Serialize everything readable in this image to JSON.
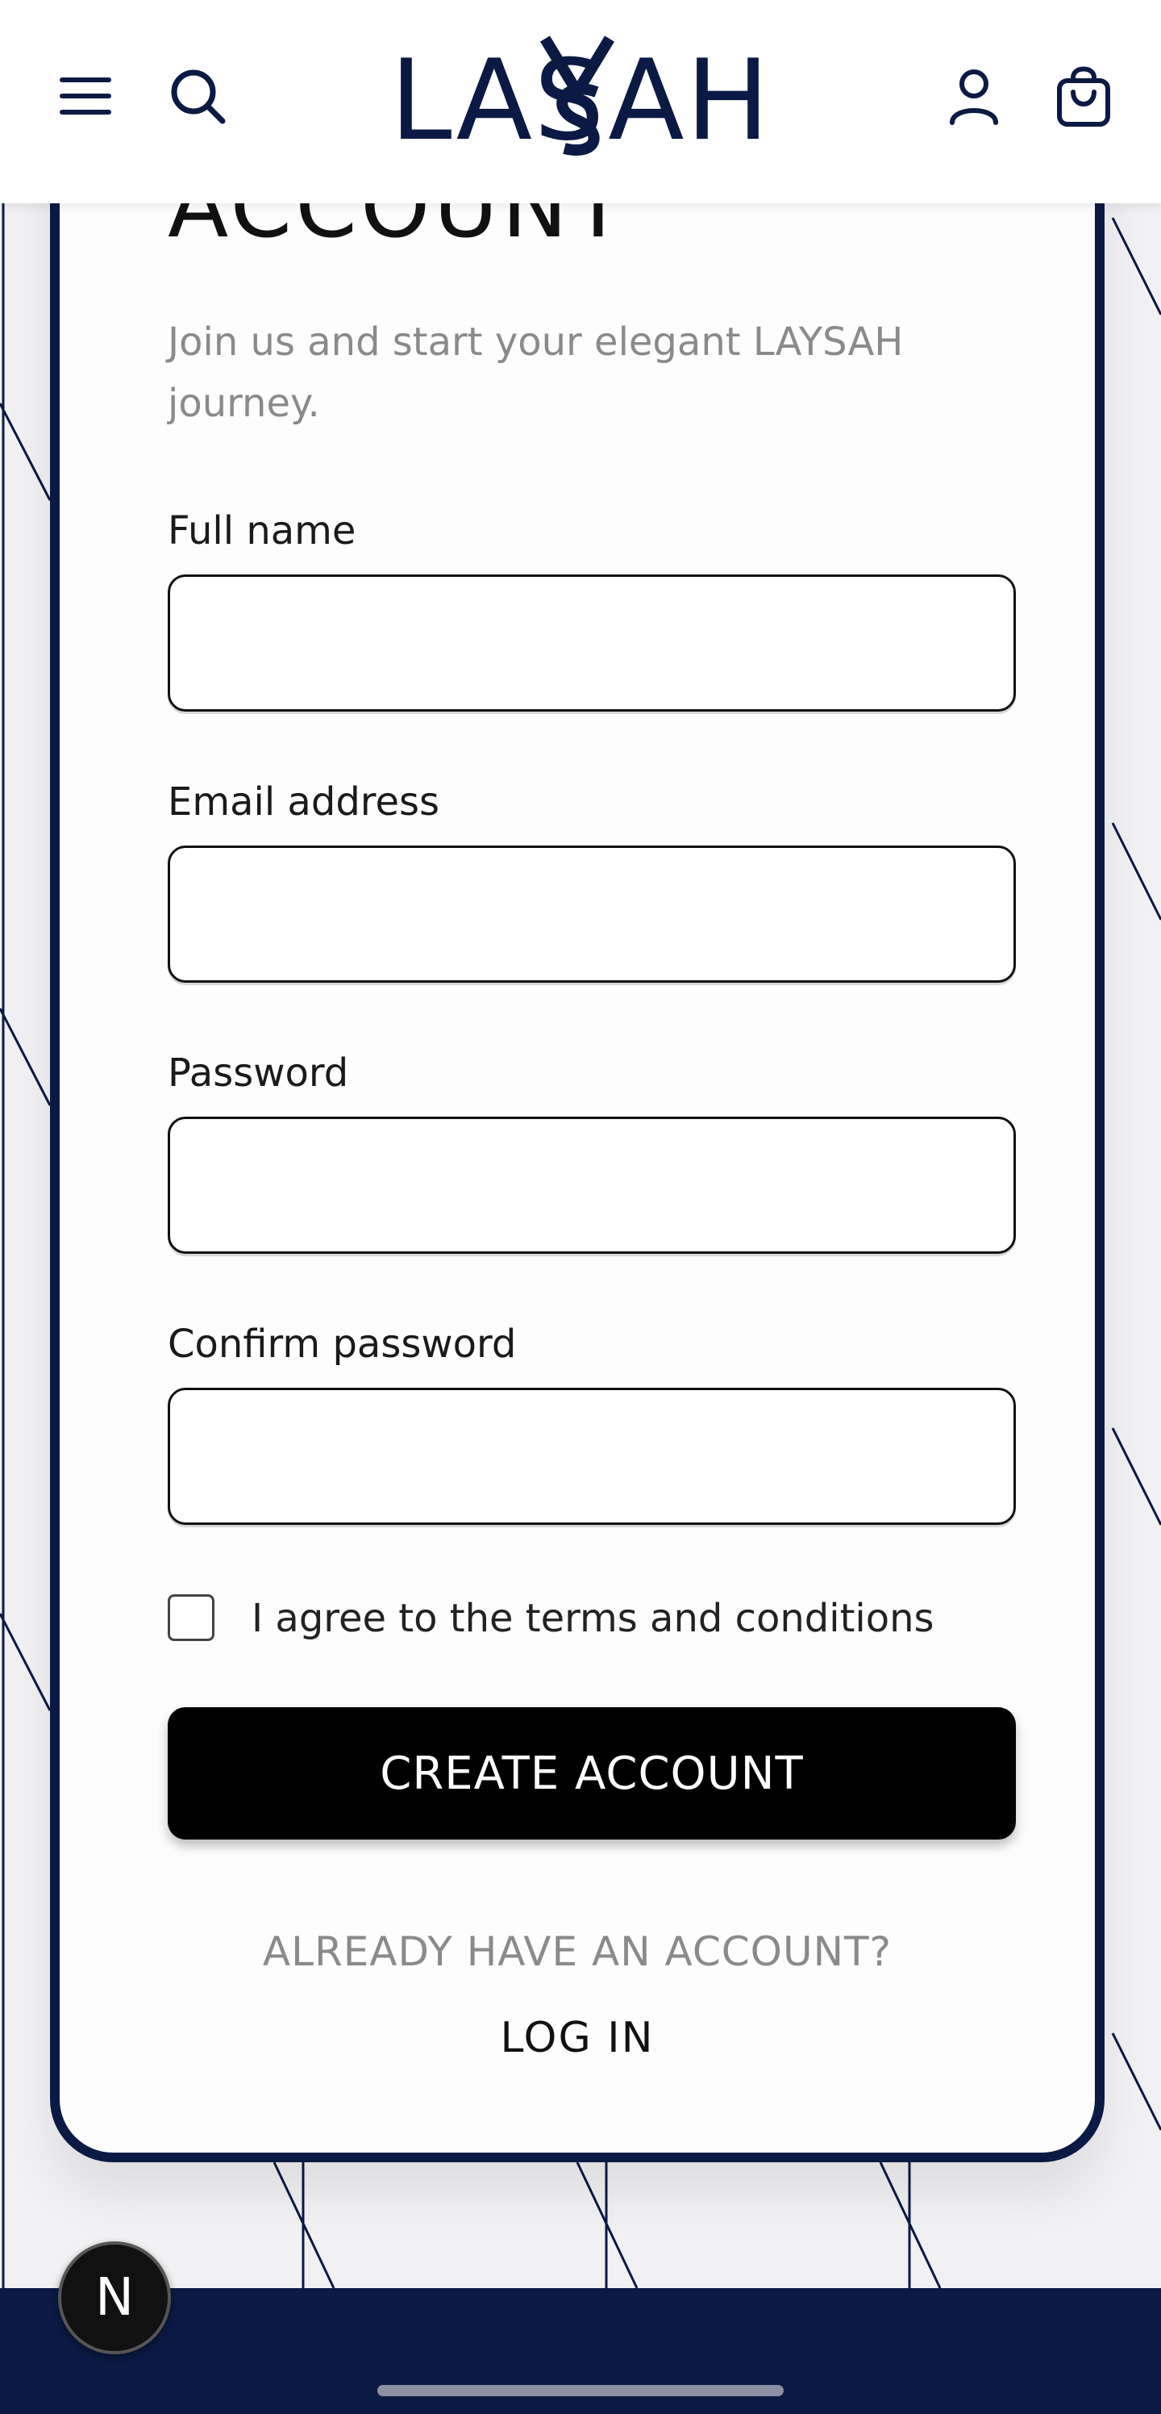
{
  "brand": {
    "logo_text": "LASAH",
    "icon_names": [
      "menu-icon",
      "search-icon",
      "account-icon",
      "cart-icon"
    ]
  },
  "form": {
    "title": "ACCOUNT",
    "subtitle": "Join us and start your elegant LAYSAH journey.",
    "fields": [
      {
        "label": "Full name",
        "value": ""
      },
      {
        "label": "Email address",
        "value": ""
      },
      {
        "label": "Password",
        "value": ""
      },
      {
        "label": "Confirm password",
        "value": ""
      }
    ],
    "terms_label": "I agree to the terms and conditions",
    "terms_checked": false,
    "submit_label": "CREATE ACCOUNT",
    "login_prompt": "ALREADY HAVE AN ACCOUNT?",
    "login_link": "LOG IN"
  },
  "dev_badge": {
    "label": "N"
  },
  "colors": {
    "brand_navy": "#0b1a44",
    "button_black": "#000000",
    "muted_text": "#8a8a8a"
  }
}
